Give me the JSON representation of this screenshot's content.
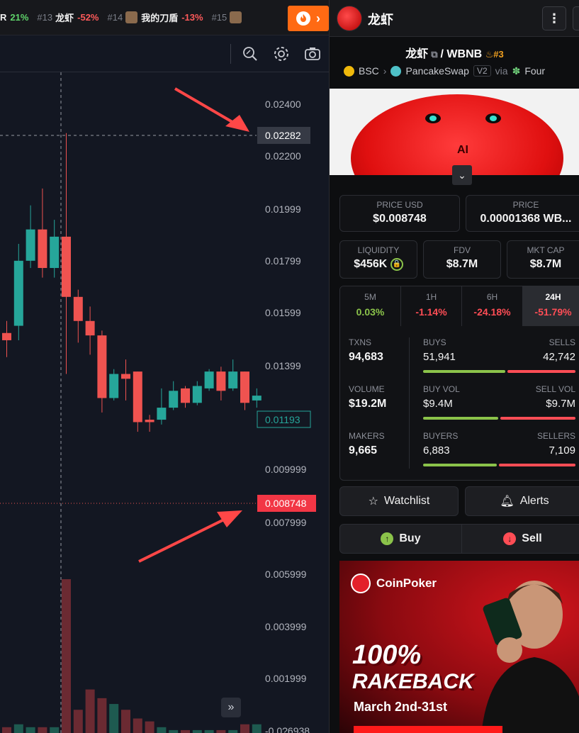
{
  "ticker": {
    "items": [
      {
        "rank": "",
        "name": "R",
        "change": "21%",
        "dir": "up",
        "img": false
      },
      {
        "rank": "#13",
        "name": "龙虾",
        "change": "-52%",
        "dir": "down",
        "img": false
      },
      {
        "rank": "#14",
        "name": "我的刀盾",
        "change": "-13%",
        "dir": "down",
        "img": true
      },
      {
        "rank": "#15",
        "name": "",
        "change": "",
        "dir": "down",
        "img": true
      }
    ],
    "fire_icon": "fire-icon"
  },
  "toolbar": {
    "icons": [
      "zoom-search-icon",
      "gear-icon",
      "camera-icon"
    ]
  },
  "chart_data": {
    "type": "candlestick",
    "y_ticks": [
      "0.02400",
      "0.02200",
      "0.01999",
      "0.01799",
      "0.01599",
      "0.01399",
      "0.009999",
      "0.007999",
      "0.005999",
      "0.003999",
      "0.001999",
      "-0.0?6938"
    ],
    "crosshair_price": "0.02282",
    "ma_price": "0.01193",
    "current_price": "0.008748",
    "ylim": [
      -0.0001,
      0.0255
    ],
    "candles": [
      {
        "o": 0.0145,
        "h": 0.015,
        "c": 0.0142,
        "l": 0.0135
      },
      {
        "o": 0.0148,
        "h": 0.0182,
        "c": 0.0175,
        "l": 0.0142
      },
      {
        "o": 0.0175,
        "h": 0.0198,
        "c": 0.0188,
        "l": 0.0172
      },
      {
        "o": 0.0188,
        "h": 0.0205,
        "c": 0.0172,
        "l": 0.0168
      },
      {
        "o": 0.0172,
        "h": 0.0192,
        "c": 0.0185,
        "l": 0.0168
      },
      {
        "o": 0.0185,
        "h": 0.0228,
        "c": 0.016,
        "l": 0.0128
      },
      {
        "o": 0.016,
        "h": 0.0163,
        "c": 0.015,
        "l": 0.0141
      },
      {
        "o": 0.015,
        "h": 0.0156,
        "c": 0.0144,
        "l": 0.0136
      },
      {
        "o": 0.0144,
        "h": 0.0146,
        "c": 0.0118,
        "l": 0.0112
      },
      {
        "o": 0.0118,
        "h": 0.013,
        "c": 0.0128,
        "l": 0.0117
      },
      {
        "o": 0.0128,
        "h": 0.0134,
        "c": 0.0126,
        "l": 0.0117
      },
      {
        "o": 0.0129,
        "h": 0.0129,
        "c": 0.0108,
        "l": 0.0104
      },
      {
        "o": 0.0109,
        "h": 0.0111,
        "c": 0.0108,
        "l": 0.0104
      },
      {
        "o": 0.0109,
        "h": 0.0122,
        "c": 0.0114,
        "l": 0.0107
      },
      {
        "o": 0.0114,
        "h": 0.0125,
        "c": 0.0121,
        "l": 0.0113
      },
      {
        "o": 0.0122,
        "h": 0.0123,
        "c": 0.0116,
        "l": 0.0114
      },
      {
        "o": 0.0116,
        "h": 0.0125,
        "c": 0.0123,
        "l": 0.0115
      },
      {
        "o": 0.0122,
        "h": 0.013,
        "c": 0.0129,
        "l": 0.0121
      },
      {
        "o": 0.0129,
        "h": 0.0131,
        "c": 0.0121,
        "l": 0.0117
      },
      {
        "o": 0.0122,
        "h": 0.0134,
        "c": 0.0129,
        "l": 0.0121
      },
      {
        "o": 0.0129,
        "h": 0.0129,
        "c": 0.0116,
        "l": 0.0113
      },
      {
        "o": 0.0117,
        "h": 0.0122,
        "c": 0.0119,
        "l": 0.0114
      }
    ],
    "volumes": [
      0.0002,
      0.0003,
      0.0002,
      0.0002,
      0.0002,
      0.0053,
      0.0008,
      0.0015,
      0.0012,
      0.001,
      0.0008,
      0.0005,
      0.0004,
      0.0002,
      0.0001,
      0.0001,
      0.0001,
      0.0001,
      0.0001,
      0.0001,
      0.0003,
      0.0003
    ]
  },
  "panel": {
    "title": "龙虾",
    "menu_icon": "more-vertical-icon",
    "pair": {
      "base": "龙虾",
      "quote": "/ WBNB",
      "rank": "#3"
    },
    "chain": "BSC",
    "dex": "PancakeSwap",
    "version": "V2",
    "via": "via",
    "via_name": "Four",
    "banner_text": "AI",
    "price_usd_label": "PRICE USD",
    "price_usd": "$0.008748",
    "price_label": "PRICE",
    "price": "0.00001368 WB...",
    "liquidity_label": "LIQUIDITY",
    "liquidity": "$456K",
    "fdv_label": "FDV",
    "fdv": "$8.7M",
    "mktcap_label": "MKT CAP",
    "mktcap": "$8.7M",
    "timeframes": [
      {
        "label": "5M",
        "value": "0.03%",
        "dir": "up"
      },
      {
        "label": "1H",
        "value": "-1.14%",
        "dir": "down"
      },
      {
        "label": "6H",
        "value": "-24.18%",
        "dir": "down"
      },
      {
        "label": "24H",
        "value": "-51.79%",
        "dir": "down"
      }
    ],
    "txns_label": "TXNS",
    "txns": "94,683",
    "volume_label": "VOLUME",
    "volume": "$19.2M",
    "makers_label": "MAKERS",
    "makers": "9,665",
    "buys_label": "BUYS",
    "buys": "51,941",
    "sells_label": "SELLS",
    "sells": "42,742",
    "buyvol_label": "BUY VOL",
    "buyvol": "$9.4M",
    "sellvol_label": "SELL VOL",
    "sellvol": "$9.7M",
    "buyers_label": "BUYERS",
    "buyers": "6,883",
    "sellers_label": "SELLERS",
    "sellers": "7,109",
    "watchlist": "Watchlist",
    "alerts": "Alerts",
    "buy": "Buy",
    "sell": "Sell"
  },
  "ad": {
    "brand": "CoinPoker",
    "headline1": "100%",
    "headline2": "RAKEBACK",
    "date": "March 2nd-31st"
  },
  "colors": {
    "up": "#26a69a",
    "down": "#ef5350",
    "accent": "#ff6a13"
  }
}
